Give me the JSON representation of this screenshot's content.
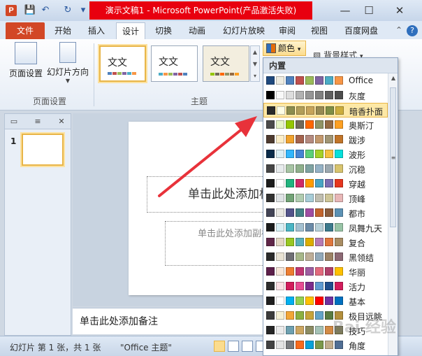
{
  "window": {
    "title": "演示文稿1 - Microsoft PowerPoint(产品激活失败)",
    "minimize": "—",
    "maximize": "☐",
    "close": "✕",
    "app_logo": "P",
    "qat": {
      "save": "💾",
      "undo": "↶",
      "redo": "↻",
      "more": "▾"
    }
  },
  "tabs": {
    "file": "文件",
    "items": [
      "开始",
      "插入",
      "设计",
      "切换",
      "动画",
      "幻灯片放映",
      "审阅",
      "视图",
      "百度网盘"
    ],
    "active": "设计",
    "help": "?"
  },
  "ribbon": {
    "page_setup": "页面设置",
    "slide_orientation": "幻灯片方向",
    "group_page_setup": "页面设置",
    "group_theme": "主题",
    "theme_thumb_text": "文文",
    "colors_button": "颜色",
    "background_styles": "背景样式"
  },
  "left_panel": {
    "slide_number": "1",
    "close": "✕",
    "tab_slides": "▭",
    "tab_outline": "≡"
  },
  "slide": {
    "title_placeholder": "单击此处添加标题",
    "subtitle_placeholder": "单击此处添加副标题"
  },
  "notes": {
    "placeholder": "单击此处添加备注"
  },
  "statusbar": {
    "slide_info": "幻灯片 第 1 张，共 1 张",
    "theme_name": "\"Office 主题\""
  },
  "dropdown": {
    "header": "内置",
    "hovered": "暗香扑面",
    "items": [
      {
        "label": "Office",
        "colors": [
          "#1f497d",
          "#eeece1",
          "#4f81bd",
          "#c0504d",
          "#9bbb59",
          "#8064a2",
          "#4bacc6",
          "#f79646"
        ]
      },
      {
        "label": "灰度",
        "colors": [
          "#000000",
          "#f8f8f8",
          "#dddddd",
          "#b2b2b2",
          "#969696",
          "#808080",
          "#5f5f5f",
          "#4d4d4d"
        ]
      },
      {
        "label": "暗香扑面",
        "colors": [
          "#2a2a2a",
          "#fdfde6",
          "#8c8d4f",
          "#b29e59",
          "#c6a45b",
          "#978a52",
          "#7f8e45",
          "#ccad3c"
        ]
      },
      {
        "label": "奥斯汀",
        "colors": [
          "#4b4b4b",
          "#e7f4c7",
          "#94c600",
          "#71685a",
          "#ff6700",
          "#909465",
          "#956b43",
          "#fea022"
        ]
      },
      {
        "label": "跋涉",
        "colors": [
          "#4e3b30",
          "#fbeec9",
          "#f0a22e",
          "#a5644e",
          "#b58b80",
          "#c3986d",
          "#a19574",
          "#c17529"
        ]
      },
      {
        "label": "波形",
        "colors": [
          "#0a2b4a",
          "#dbeef4",
          "#31b6fd",
          "#4584d3",
          "#5bd078",
          "#a5d028",
          "#f5c040",
          "#05e0db"
        ]
      },
      {
        "label": "沉稳",
        "colors": [
          "#464646",
          "#e7ebec",
          "#a7c4a4",
          "#8fb08c",
          "#7fa3a2",
          "#95b2c5",
          "#9ca9b0",
          "#d8c46e"
        ]
      },
      {
        "label": "穿越",
        "colors": [
          "#1c1c1c",
          "#ffffff",
          "#21b37e",
          "#cf2a66",
          "#ff9c00",
          "#48a5c4",
          "#7b6cb2",
          "#e6361f"
        ]
      },
      {
        "label": "顶峰",
        "colors": [
          "#323232",
          "#dfe3e5",
          "#72a376",
          "#b0ccb0",
          "#a8cdd7",
          "#c0beaf",
          "#cec597",
          "#e8b7b7"
        ]
      },
      {
        "label": "都市",
        "colors": [
          "#424456",
          "#e8e7e2",
          "#53548a",
          "#438086",
          "#a04da3",
          "#c4652d",
          "#8b5d3d",
          "#5c92b5"
        ]
      },
      {
        "label": "凤舞九天",
        "colors": [
          "#1c1c1c",
          "#d9f0f5",
          "#4ab5c4",
          "#a3c0d0",
          "#6b8ba8",
          "#b8d1d9",
          "#3c7a8c",
          "#98c4a6"
        ]
      },
      {
        "label": "复合",
        "colors": [
          "#5f2648",
          "#e3d7c3",
          "#98c723",
          "#59b0b9",
          "#deae00",
          "#b77bb4",
          "#e0773c",
          "#a98d63"
        ]
      },
      {
        "label": "黑领结",
        "colors": [
          "#2b2b2b",
          "#e8e2d4",
          "#6f6f74",
          "#a7b789",
          "#beae98",
          "#92a9b9",
          "#9c8265",
          "#8d6974"
        ]
      },
      {
        "label": "华丽",
        "colors": [
          "#5c1f4a",
          "#f7e6d8",
          "#ed7d31",
          "#c13773",
          "#9e5ea1",
          "#e26a7d",
          "#b0406a",
          "#ffc000"
        ]
      },
      {
        "label": "活力",
        "colors": [
          "#2d2d2d",
          "#fbe0e5",
          "#d21c5c",
          "#e74b93",
          "#7b2c8c",
          "#5f9bd1",
          "#1f4e8c",
          "#d21c5c"
        ]
      },
      {
        "label": "基本",
        "colors": [
          "#1f1f1f",
          "#ffffff",
          "#00b0f0",
          "#92d050",
          "#ffc000",
          "#ff0000",
          "#7030a0",
          "#0070c0"
        ]
      },
      {
        "label": "极目远眺",
        "colors": [
          "#3c3c3c",
          "#f5f0d5",
          "#f2a637",
          "#8cb040",
          "#c8a43a",
          "#63a3c7",
          "#597b41",
          "#b38f3c"
        ]
      },
      {
        "label": "技巧",
        "colors": [
          "#262626",
          "#ebebeb",
          "#6ea0b0",
          "#cca661",
          "#8c8c64",
          "#a5c2b6",
          "#d28a45",
          "#7e7b57"
        ]
      },
      {
        "label": "角度",
        "colors": [
          "#424242",
          "#e3e3e3",
          "#797b7e",
          "#f96a1b",
          "#08a1d9",
          "#7c984a",
          "#c2ad8d",
          "#506e94"
        ]
      }
    ]
  }
}
